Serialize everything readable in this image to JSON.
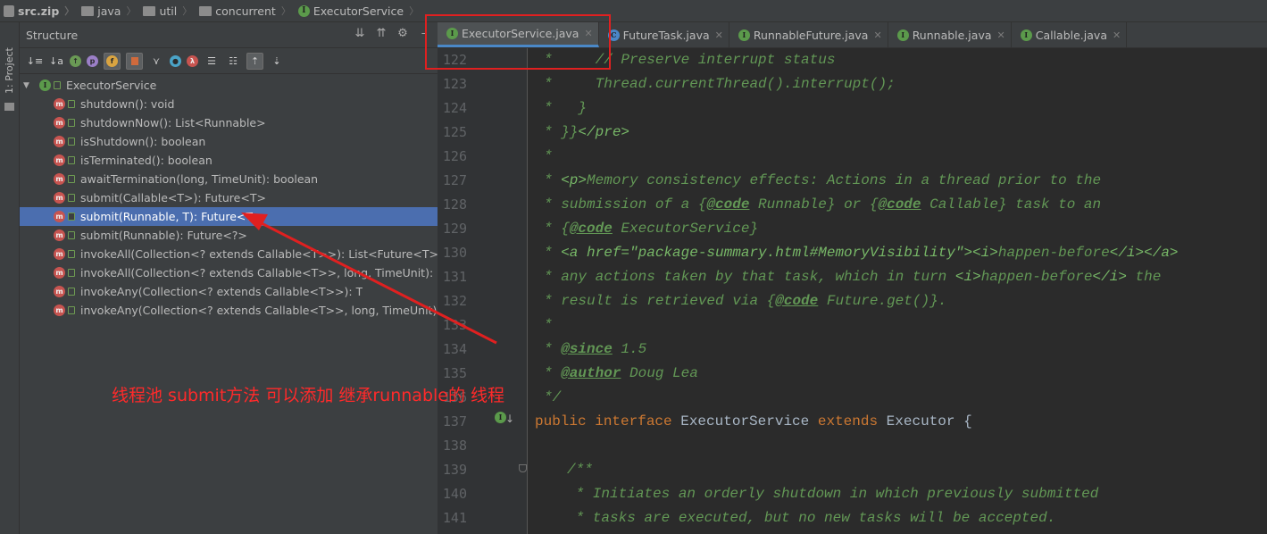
{
  "breadcrumb": [
    {
      "label": "src.zip",
      "icon": "zip-icon"
    },
    {
      "label": "java",
      "icon": "folder-icon"
    },
    {
      "label": "util",
      "icon": "folder-icon"
    },
    {
      "label": "concurrent",
      "icon": "folder-icon"
    },
    {
      "label": "ExecutorService",
      "icon": "interface-icon"
    }
  ],
  "left_strip": {
    "label": "1: Project"
  },
  "structure": {
    "title": "Structure",
    "root": "ExecutorService",
    "items": [
      "shutdown(): void",
      "shutdownNow(): List<Runnable>",
      "isShutdown(): boolean",
      "isTerminated(): boolean",
      "awaitTermination(long, TimeUnit): boolean",
      "submit(Callable<T>): Future<T>",
      "submit(Runnable, T): Future<T>",
      "submit(Runnable): Future<?>",
      "invokeAll(Collection<? extends Callable<T>>): List<Future<T>>",
      "invokeAll(Collection<? extends Callable<T>>, long, TimeUnit): List<Future<T>>",
      "invokeAny(Collection<? extends Callable<T>>): T",
      "invokeAny(Collection<? extends Callable<T>>, long, TimeUnit): T"
    ],
    "selected_index": 6,
    "toolbar_badges": {
      "p": "p",
      "f": "f",
      "lambda": "λ"
    }
  },
  "tabs": [
    {
      "label": "ExecutorService.java",
      "kind": "interface",
      "active": true
    },
    {
      "label": "FutureTask.java",
      "kind": "class",
      "active": false
    },
    {
      "label": "RunnableFuture.java",
      "kind": "interface",
      "active": false
    },
    {
      "label": "Runnable.java",
      "kind": "interface",
      "active": false
    },
    {
      "label": "Callable.java",
      "kind": "interface",
      "active": false
    }
  ],
  "editor": {
    "line_numbers": [
      "122",
      "123",
      "124",
      "125",
      "126",
      "127",
      "128",
      "129",
      "130",
      "131",
      "132",
      "133",
      "134",
      "135",
      "136",
      "137",
      "138",
      "139",
      "140",
      "141"
    ],
    "lines": {
      "l122": "*     // Preserve interrupt status",
      "l123": "*     Thread.currentThread().interrupt();",
      "l124": "*   }",
      "l125a": "* }}",
      "l125b": "</pre>",
      "l126": "*",
      "l127a": "* ",
      "l127b": "<p>",
      "l127c": "Memory consistency effects: Actions in a thread prior to the",
      "l128a": "* submission of a {",
      "l128b": "@code",
      "l128c": " Runnable} or {",
      "l128d": "@code",
      "l128e": " Callable} task to an",
      "l129a": "* {",
      "l129b": "@code",
      "l129c": " ExecutorService}",
      "l130a": "* ",
      "l130b": "<a href=\"package-summary.html#MemoryVisibility\"><i>",
      "l130c": "happen-before",
      "l130d": "</i></a>",
      "l131a": "* any actions taken by that task, which in turn ",
      "l131b": "<i>",
      "l131c": "happen-before",
      "l131d": "</i>",
      "l131e": " the",
      "l132a": "* result is retrieved via {",
      "l132b": "@code",
      "l132c": " Future.get()}.",
      "l133": "*",
      "l134a": "* ",
      "l134b": "@since",
      "l134c": " 1.5",
      "l135a": "* ",
      "l135b": "@author",
      "l135c": " Doug Lea",
      "l136": "*/",
      "l137a": "public interface",
      "l137b": " ExecutorService ",
      "l137c": "extends",
      "l137d": " Executor {",
      "l139": "/**",
      "l140": " * Initiates an orderly shutdown in which previously submitted",
      "l141": " * tasks are executed, but no new tasks will be accepted."
    }
  },
  "annotation": {
    "text": "线程池 submit方法 可以添加 继承runnable的 线程",
    "color": "#ff2a2a"
  },
  "colors": {
    "accent": "#4b6eaf",
    "comment": "#629755",
    "keyword": "#cc7832",
    "highlight": "#e02020"
  }
}
